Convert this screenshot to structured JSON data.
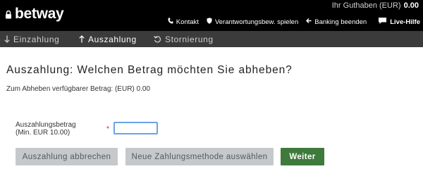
{
  "header": {
    "brand": "betway",
    "balance_label": "Ihr Guthaben (EUR)",
    "balance_value": "0.00",
    "links": [
      {
        "label": "Kontakt",
        "icon": "phone-icon"
      },
      {
        "label": "Verantwortungsbew. spielen",
        "icon": "shield-icon"
      },
      {
        "label": "Banking beenden",
        "icon": "arrow-left-icon"
      },
      {
        "label": "Live-Hilfe",
        "icon": "chat-bubble-icon"
      }
    ]
  },
  "nav": {
    "tabs": [
      {
        "label": "Einzahlung",
        "icon": "arrow-down-icon",
        "active": false
      },
      {
        "label": "Auszahlung",
        "icon": "arrow-up-icon",
        "active": true
      },
      {
        "label": "Stornierung",
        "icon": "undo-icon",
        "active": false
      }
    ]
  },
  "main": {
    "title": "Auszahlung: Welchen Betrag möchten Sie abheben?",
    "available_text": "Zum Abheben verfügbarer Betrag: (EUR) 0.00",
    "amount_field": {
      "label_line1": "Auszahlungsbetrag",
      "label_line2": "(Min. EUR 10.00)",
      "required_marker": "*",
      "value": ""
    },
    "buttons": {
      "cancel": "Auszahlung abbrechen",
      "new_method": "Neue Zahlungsmethode auswählen",
      "next": "Weiter"
    }
  },
  "colors": {
    "topbar": "#000000",
    "nav": "#3b3b3b",
    "primary_button": "#3d7a3b",
    "secondary_button": "#c6c9cc",
    "required": "#d21f1f",
    "input_focus": "#6aa3e8"
  }
}
